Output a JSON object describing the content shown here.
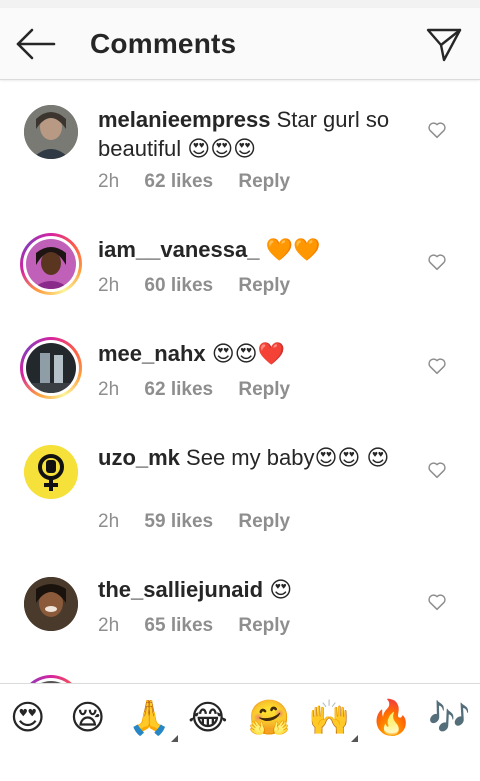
{
  "header": {
    "title": "Comments"
  },
  "comments": [
    {
      "username": "melanieempress",
      "text": "Star gurl so beautiful 😍😍😍",
      "time": "2h",
      "likes": "62 likes",
      "reply": "Reply",
      "has_story_ring": false
    },
    {
      "username": "iam__vanessa_",
      "text": "🧡🧡",
      "time": "2h",
      "likes": "60 likes",
      "reply": "Reply",
      "has_story_ring": true
    },
    {
      "username": "mee_nahx",
      "text": "😍😍❤️",
      "time": "2h",
      "likes": "62 likes",
      "reply": "Reply",
      "has_story_ring": true
    },
    {
      "username": "uzo_mk",
      "text": "See my baby😍😍 😍",
      "time": "2h",
      "likes": "59 likes",
      "reply": "Reply",
      "has_story_ring": false
    },
    {
      "username": "the_salliejunaid",
      "text": "😍",
      "time": "2h",
      "likes": "65 likes",
      "reply": "Reply",
      "has_story_ring": false
    }
  ],
  "emoji_bar": [
    "😍",
    "😪",
    "🙏",
    "😂",
    "🤗",
    "🙌",
    "🔥",
    "🎶"
  ],
  "colors": {
    "text": "#262626",
    "meta": "#8e8e8e",
    "divider": "#dbdbdb",
    "header_bg": "#fafafa"
  }
}
